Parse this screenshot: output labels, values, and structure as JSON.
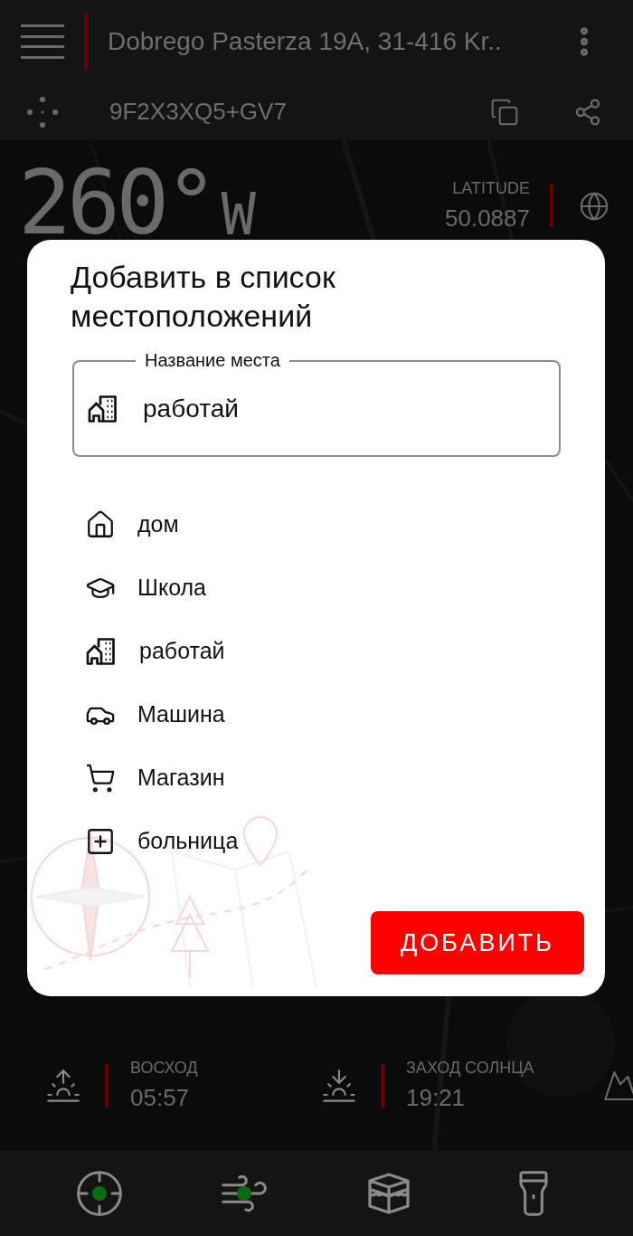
{
  "header": {
    "address": "Dobrego Pasterza 19A, 31-416 Kr..",
    "plus_code": "9F2X3XQ5+GV7"
  },
  "heading": {
    "degrees": "260°",
    "direction": "W"
  },
  "latitude": {
    "label": "LATITUDE",
    "value": "50.0887"
  },
  "dialog": {
    "title": "Добавить в список местоположений",
    "field": {
      "label": "Название места",
      "value": "работай",
      "kind": "work"
    },
    "items": [
      {
        "label": "дом",
        "kind": "home"
      },
      {
        "label": "Школа",
        "kind": "school"
      },
      {
        "label": "работай",
        "kind": "work"
      },
      {
        "label": "Машина",
        "kind": "car"
      },
      {
        "label": "Магазин",
        "kind": "shop"
      },
      {
        "label": "больница",
        "kind": "hospital"
      }
    ],
    "button": "ДОБАВИТЬ"
  },
  "sun": [
    {
      "label": "ВОСХОД",
      "time": "05:57",
      "kind": "sunrise"
    },
    {
      "label": "ЗАХОД СОЛНЦА",
      "time": "19:21",
      "kind": "sunset"
    }
  ],
  "bottom_nav": [
    {
      "kind": "target",
      "status_dot": true
    },
    {
      "kind": "wind",
      "status_dot": true
    },
    {
      "kind": "kaaba",
      "status_dot": false
    },
    {
      "kind": "flashlight",
      "status_dot": false
    }
  ]
}
